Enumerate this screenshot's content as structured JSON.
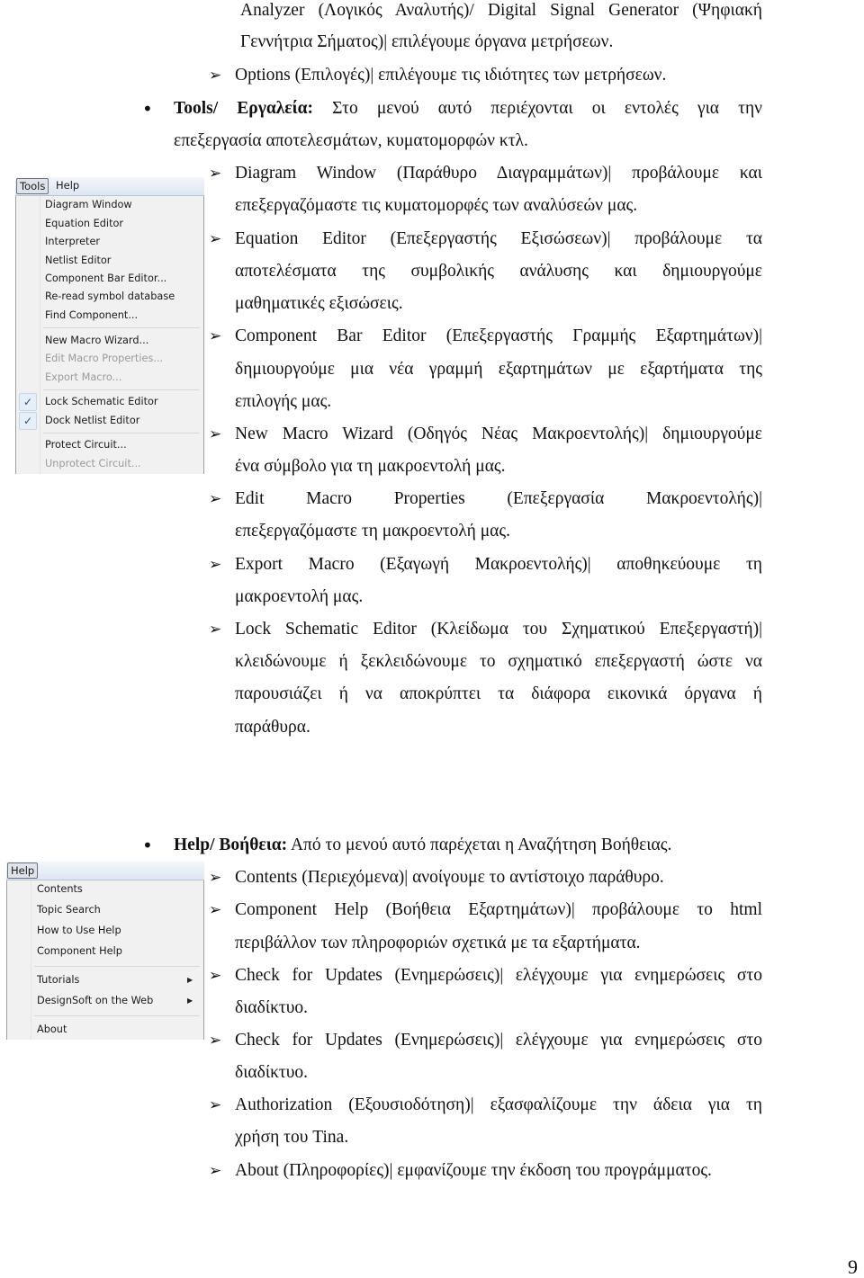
{
  "document": {
    "top_continuation": {
      "line1": "Analyzer (Λογικός Αναλυτής)/ Digital Signal Generator (Ψηφιακή",
      "line2": "Γεννήτρια Σήματος)| επιλέγουμε όργανα μετρήσεων."
    },
    "options_item": "Options (Επιλογές)| επιλέγουμε τις ιδιότητες των μετρήσεων.",
    "tools_section": {
      "heading_bold": "Tools/ Εργαλεία:",
      "heading_rest": " Στο μενού αυτό περιέχονται οι εντολές για την",
      "heading_line2": "επεξεργασία αποτελεσμάτων, κυματομορφών κτλ.",
      "items": [
        {
          "lines": [
            "Diagram Window (Παράθυρο Διαγραμμάτων)| προβάλουμε και",
            "επεξεργαζόμαστε τις κυματομορφές των αναλύσεών μας."
          ]
        },
        {
          "lines": [
            "Equation Editor (Επεξεργαστής Εξισώσεων)| προβάλουμε τα",
            "αποτελέσματα της συμβολικής ανάλυσης και δημιουργούμε",
            "μαθηματικές εξισώσεις."
          ]
        },
        {
          "lines": [
            "Component Bar Editor (Επεξεργαστής Γραμμής Εξαρτημάτων)|",
            "δημιουργούμε μια νέα γραμμή εξαρτημάτων με εξαρτήματα της",
            "επιλογής μας."
          ]
        },
        {
          "lines": [
            "New Macro Wizard (Οδηγός Νέας Μακροεντολής)| δημιουργούμε",
            "ένα σύμβολο για τη μακροεντολή μας."
          ]
        },
        {
          "lines": [
            "Edit Macro Properties (Επεξεργασία Μακροεντολής)|",
            "επεξεργαζόμαστε τη μακροεντολή μας."
          ]
        },
        {
          "lines": [
            "Export Macro (Εξαγωγή Μακροεντολής)| αποθηκεύουμε τη",
            "μακροεντολή μας."
          ]
        },
        {
          "lines": [
            "Lock Schematic Editor (Κλείδωμα του Σχηματικού Επεξεργαστή)|",
            "κλειδώνουμε ή ξεκλειδώνουμε το σχηματικό επεξεργαστή ώστε να",
            "παρουσιάζει ή να αποκρύπτει τα διάφορα εικονικά όργανα ή",
            "παράθυρα."
          ]
        }
      ]
    },
    "help_section": {
      "heading_bold": "Help/ Βοήθεια:",
      "heading_rest": " Από το μενού αυτό παρέχεται η Αναζήτηση Βοήθειας.",
      "items": [
        {
          "lines": [
            "Contents (Περιεχόμενα)| ανοίγουμε το αντίστοιχο παράθυρο."
          ]
        },
        {
          "lines": [
            "Component Help (Βοήθεια Εξαρτημάτων)| προβάλουμε το html",
            "περιβάλλον των πληροφοριών σχετικά με τα εξαρτήματα."
          ]
        },
        {
          "lines": [
            "Check for Updates (Ενημερώσεις)| ελέγχουμε για ενημερώσεις στο",
            "διαδίκτυο."
          ]
        },
        {
          "lines": [
            "Check for Updates (Ενημερώσεις)| ελέγχουμε για ενημερώσεις στο",
            "διαδίκτυο."
          ]
        },
        {
          "lines": [
            "Authorization (Εξουσιοδότηση)| εξασφαλίζουμε την άδεια για τη",
            "χρήση του Tina."
          ]
        },
        {
          "lines": [
            "About (Πληροφορίες)| εμφανίζουμε την έκδοση του προγράμματος."
          ]
        }
      ]
    },
    "page_number": "9"
  },
  "tools_menu": {
    "menubar": [
      "Tools",
      "Help"
    ],
    "active": "Tools",
    "items": [
      {
        "label": "Diagram Window",
        "enabled": true
      },
      {
        "label": "Equation Editor",
        "enabled": true
      },
      {
        "label": "Interpreter",
        "enabled": true
      },
      {
        "label": "Netlist Editor",
        "enabled": true
      },
      {
        "label": "Component Bar Editor...",
        "enabled": true
      },
      {
        "label": "Re-read symbol database",
        "enabled": true
      },
      {
        "label": "Find Component...",
        "enabled": true
      },
      {
        "label": "New Macro Wizard...",
        "enabled": true
      },
      {
        "label": "Edit Macro Properties...",
        "enabled": false
      },
      {
        "label": "Export Macro...",
        "enabled": false
      },
      {
        "label": "Lock Schematic Editor",
        "enabled": true,
        "checked": true
      },
      {
        "label": "Dock Netlist Editor",
        "enabled": true,
        "checked": true
      },
      {
        "label": "Protect Circuit...",
        "enabled": true
      },
      {
        "label": "Unprotect Circuit...",
        "enabled": false
      }
    ],
    "check_glyph": "✓"
  },
  "help_menu": {
    "menubar": [
      "Help"
    ],
    "active": "Help",
    "items": [
      {
        "label": "Contents"
      },
      {
        "label": "Topic Search"
      },
      {
        "label": "How to Use Help"
      },
      {
        "label": "Component Help"
      },
      {
        "label": "Tutorials",
        "submenu": true
      },
      {
        "label": "DesignSoft on the Web",
        "submenu": true
      },
      {
        "label": "About"
      }
    ],
    "submenu_glyph": "▶"
  },
  "glyphs": {
    "arrow": "➢",
    "bullet": "•"
  }
}
